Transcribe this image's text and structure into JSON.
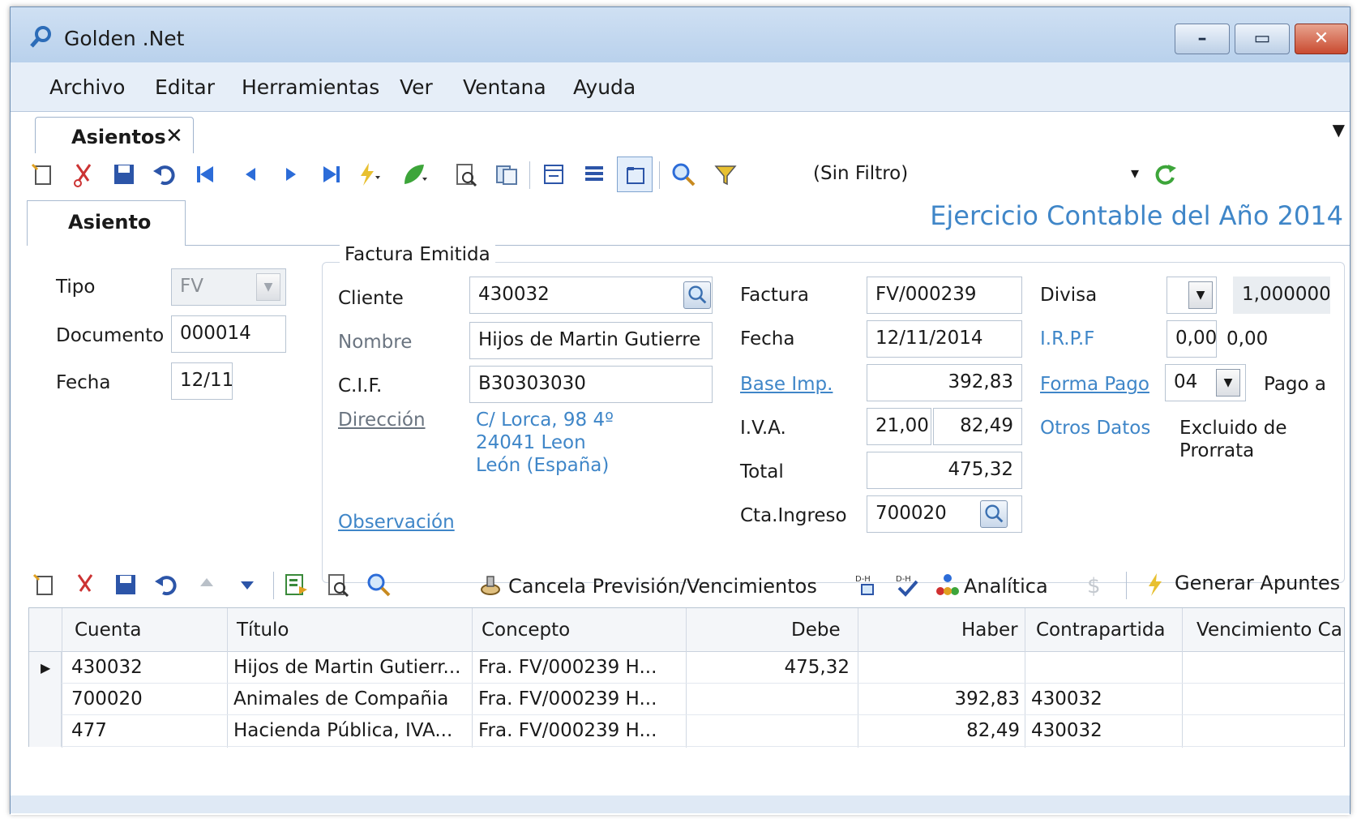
{
  "window": {
    "title": "Golden .Net"
  },
  "menu": [
    "Archivo",
    "Editar",
    "Herramientas",
    "Ver",
    "Ventana",
    "Ayuda"
  ],
  "doc_tab": {
    "label": "Asientos",
    "close": "✕"
  },
  "toolbar": {
    "filter": "(Sin Filtro)"
  },
  "section_tab": "Asiento",
  "ejercicio": "Ejercicio Contable del Año 2014",
  "left": {
    "tipo_label": "Tipo",
    "tipo_value": "FV",
    "documento_label": "Documento",
    "documento_value": "000014",
    "fecha_label": "Fecha",
    "fecha_value": "12/11"
  },
  "factura": {
    "group_title": "Factura Emitida",
    "cliente_label": "Cliente",
    "cliente_value": "430032",
    "nombre_label": "Nombre",
    "nombre_value": "Hijos de Martin Gutierre",
    "cif_label": "C.I.F.",
    "cif_value": "B30303030",
    "direccion_label": "Dirección",
    "direccion_lines": [
      "C/ Lorca, 98  4º",
      "24041 Leon",
      "León (España)"
    ],
    "observacion_label": "Observación",
    "factura_label": "Factura",
    "factura_value": "FV/000239",
    "fecha_label": "Fecha",
    "fecha_value": "12/11/2014",
    "base_label": "Base Imp.",
    "base_value": "392,83",
    "iva_label": "I.V.A.",
    "iva_pct": "21,00",
    "iva_value": "82,49",
    "total_label": "Total",
    "total_value": "475,32",
    "cta_label": "Cta.Ingreso",
    "cta_value": "700020",
    "divisa_label": "Divisa",
    "divisa_value": "1,000000",
    "irpf_label": "I.R.P.F",
    "irpf_pct": "0,00",
    "irpf_value": "0,00",
    "forma_label": "Forma Pago",
    "forma_value": "04",
    "forma_desc": "Pago a",
    "otros_label": "Otros Datos",
    "otros_lines": [
      "Excluido de",
      "Prorrata"
    ]
  },
  "bottom_toolbar": {
    "cancela": "Cancela Previsión/Vencimientos",
    "analitica": "Analítica",
    "generar": "Generar Apuntes"
  },
  "grid": {
    "columns": [
      "Cuenta",
      "Título",
      "Concepto",
      "Debe",
      "Haber",
      "Contrapartida",
      "Vencimiento Ca"
    ],
    "rows": [
      {
        "cuenta": "430032",
        "titulo": "Hijos de Martin Gutierr...",
        "concepto": "Fra. FV/000239  H...",
        "debe": "475,32",
        "haber": "",
        "contrapartida": "",
        "vencimiento": ""
      },
      {
        "cuenta": "700020",
        "titulo": "Animales de Compañia",
        "concepto": "Fra. FV/000239  H...",
        "debe": "",
        "haber": "392,83",
        "contrapartida": "430032",
        "vencimiento": ""
      },
      {
        "cuenta": "477",
        "titulo": "Hacienda Pública, IVA...",
        "concepto": "Fra. FV/000239  H...",
        "debe": "",
        "haber": "82,49",
        "contrapartida": "430032",
        "vencimiento": ""
      }
    ]
  },
  "colors": {
    "accent_link": "#3f86c8",
    "frame": "#dfe9f5"
  }
}
